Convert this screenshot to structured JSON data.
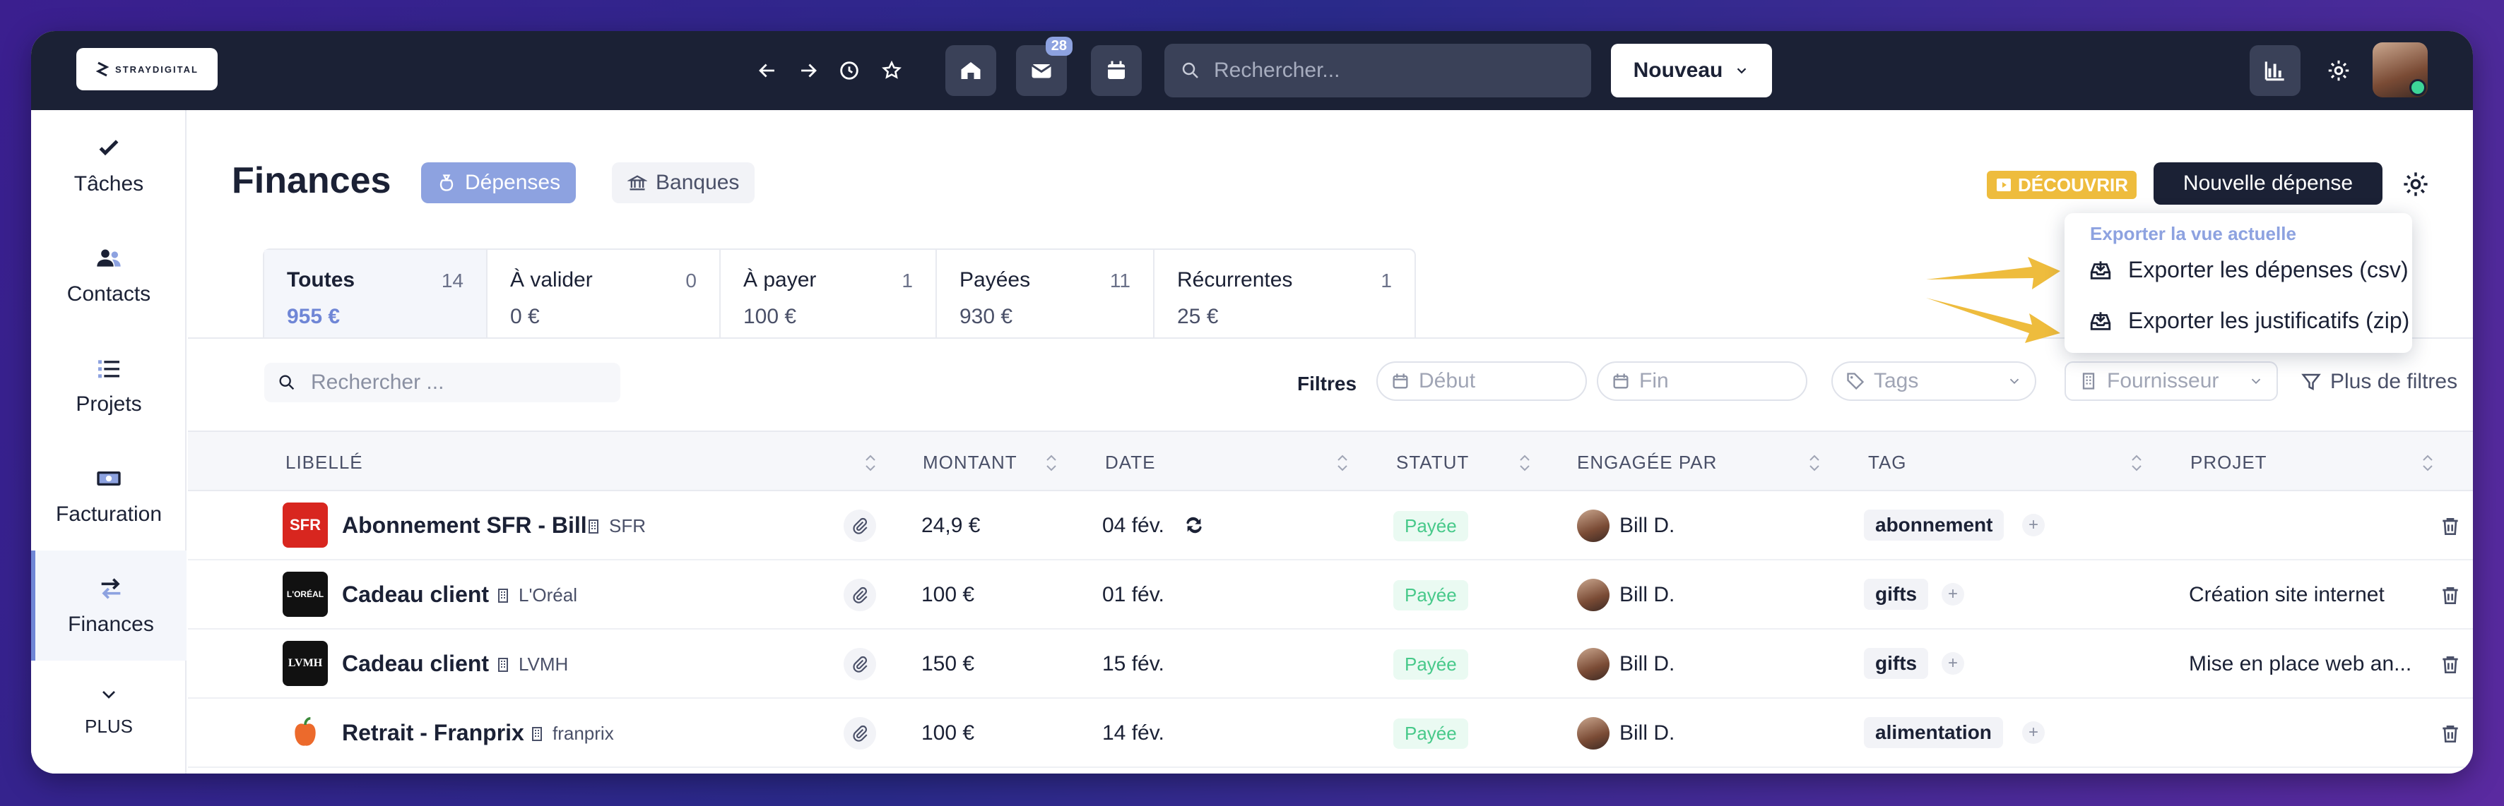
{
  "brand": {
    "logo_text": "STRAYDIGITAL"
  },
  "topbar": {
    "mail_badge": "28",
    "search_placeholder": "Rechercher...",
    "new_button": "Nouveau"
  },
  "sidebar": {
    "items": [
      {
        "label": "Tâches",
        "icon": "check-icon"
      },
      {
        "label": "Contacts",
        "icon": "users-icon"
      },
      {
        "label": "Projets",
        "icon": "list-icon"
      },
      {
        "label": "Facturation",
        "icon": "banknote-icon"
      },
      {
        "label": "Finances",
        "icon": "transfer-icon"
      },
      {
        "label": "PLUS",
        "icon": "chevron-down-icon"
      }
    ]
  },
  "page": {
    "title": "Finances",
    "tab_expenses": "Dépenses",
    "tab_banks": "Banques",
    "discover": "DÉCOUVRIR",
    "new_expense": "Nouvelle dépense"
  },
  "status_tabs": [
    {
      "label": "Toutes",
      "count": "14",
      "amount": "955 €"
    },
    {
      "label": "À valider",
      "count": "0",
      "amount": "0 €"
    },
    {
      "label": "À payer",
      "count": "1",
      "amount": "100 €"
    },
    {
      "label": "Payées",
      "count": "11",
      "amount": "930 €"
    },
    {
      "label": "Récurrentes",
      "count": "1",
      "amount": "25 €"
    }
  ],
  "filters": {
    "search_placeholder": "Rechercher ...",
    "label": "Filtres",
    "start": "Début",
    "end": "Fin",
    "tags": "Tags",
    "supplier": "Fournisseur",
    "more": "Plus de filtres"
  },
  "table": {
    "columns": [
      "LIBELLÉ",
      "MONTANT",
      "DATE",
      "STATUT",
      "ENGAGÉE PAR",
      "TAG",
      "PROJET"
    ],
    "rows": [
      {
        "name": "Abonnement SFR - Bill",
        "supplier": "SFR",
        "logo": "SFR",
        "amount": "24,9 €",
        "date": "04 fév.",
        "status": "Payée",
        "by": "Bill D.",
        "tag": "abonnement",
        "project": ""
      },
      {
        "name": "Cadeau client",
        "supplier": "L'Oréal",
        "logo": "L'ORÉAL",
        "amount": "100 €",
        "date": "01 fév.",
        "status": "Payée",
        "by": "Bill D.",
        "tag": "gifts",
        "project": "Création site internet"
      },
      {
        "name": "Cadeau client",
        "supplier": "LVMH",
        "logo": "LVMH",
        "amount": "150 €",
        "date": "15 fév.",
        "status": "Payée",
        "by": "Bill D.",
        "tag": "gifts",
        "project": "Mise en place web an..."
      },
      {
        "name": "Retrait - Franprix",
        "supplier": "franprix",
        "logo": "",
        "amount": "100 €",
        "date": "14 fév.",
        "status": "Payée",
        "by": "Bill D.",
        "tag": "alimentation",
        "project": ""
      }
    ]
  },
  "export_menu": {
    "heading": "Exporter la vue actuelle",
    "csv": "Exporter les dépenses (csv)",
    "zip": "Exporter les justificatifs (zip)"
  },
  "colors": {
    "accent": "#8da2e0",
    "dark": "#1b2135",
    "arrow": "#eebc3d",
    "paid": "#47c98a"
  }
}
